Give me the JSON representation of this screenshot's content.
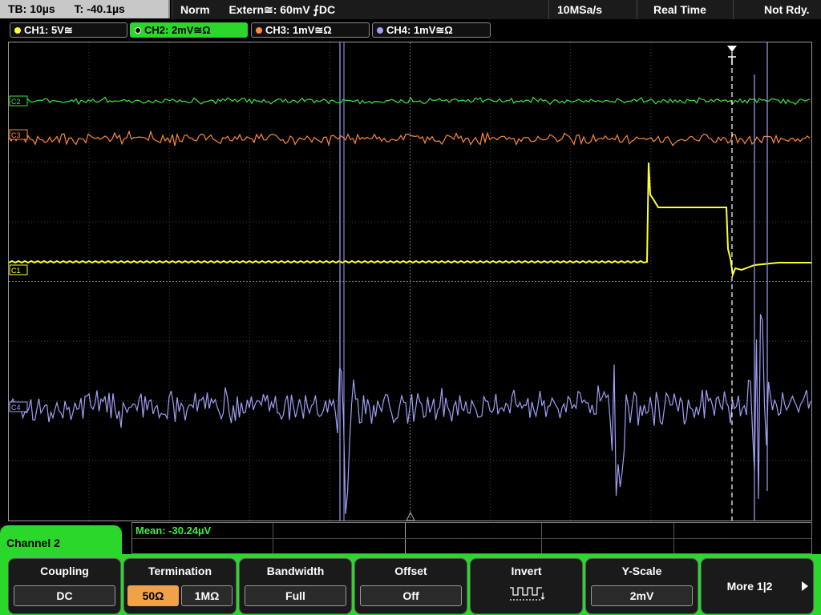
{
  "status": {
    "timebase": "TB: 10µs",
    "trigger_time": "T: -40.1µs",
    "mode": "Norm",
    "trigger": "Extern≅: 60mV ⨍DC",
    "sample_rate": "10MSa/s",
    "acq_mode": "Real Time",
    "ready_state": "Not Rdy."
  },
  "channels": [
    {
      "label": "CH1: 5V≅",
      "color": "#ffff33",
      "marker": "C1"
    },
    {
      "label": "CH2: 2mV≅Ω",
      "color": "#39e339",
      "marker": "C2"
    },
    {
      "label": "CH3: 1mV≅Ω",
      "color": "#ff8a3a",
      "marker": "C3"
    },
    {
      "label": "CH4: 1mV≅Ω",
      "color": "#9f9ff5",
      "marker": "C4"
    }
  ],
  "measurement": {
    "mean": "Mean: -30.24µV"
  },
  "menu": {
    "channel_title": "Channel 2",
    "coupling": {
      "title": "Coupling",
      "value": "DC"
    },
    "termination": {
      "title": "Termination",
      "opt_a": "50Ω",
      "opt_b": "1MΩ"
    },
    "bandwidth": {
      "title": "Bandwidth",
      "value": "Full"
    },
    "offset": {
      "title": "Offset",
      "value": "Off"
    },
    "invert": {
      "title": "Invert"
    },
    "yscale": {
      "title": "Y-Scale",
      "value": "2mV"
    },
    "more": {
      "title": "More 1|2"
    }
  }
}
